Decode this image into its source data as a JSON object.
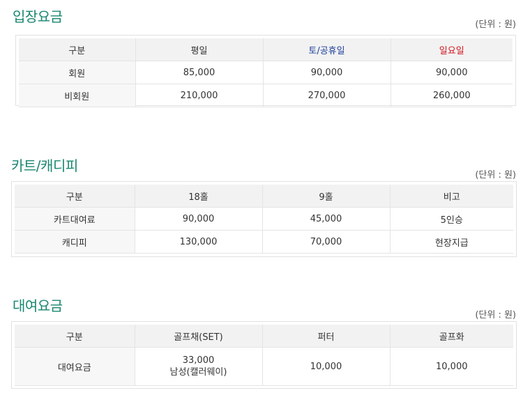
{
  "sections": [
    {
      "title": "입장요금",
      "unit": "(단위 : 원)",
      "headers": [
        "구분",
        "평일",
        "토/공휴일",
        "일요일"
      ],
      "header_colors": [
        "#333333",
        "#333333",
        "#1f3f9a",
        "#d0161f"
      ],
      "rows": [
        [
          "회원",
          "85,000",
          "90,000",
          "90,000"
        ],
        [
          "비회원",
          "210,000",
          "270,000",
          "260,000"
        ]
      ]
    },
    {
      "title": "카트/캐디피",
      "unit": "(단위 : 원)",
      "headers": [
        "구분",
        "18홀",
        "9홀",
        "비고"
      ],
      "rows": [
        [
          "카트대여료",
          "90,000",
          "45,000",
          "5인승"
        ],
        [
          "캐디피",
          "130,000",
          "70,000",
          "현장지급"
        ]
      ]
    },
    {
      "title": "대여요금",
      "unit": "(단위 : 원)",
      "headers": [
        "구분",
        "골프채(SET)",
        "퍼터",
        "골프화"
      ],
      "rows": [
        [
          "대여요금",
          [
            "33,000",
            "남성(캘러웨이)"
          ],
          "10,000",
          "10,000"
        ]
      ]
    }
  ]
}
